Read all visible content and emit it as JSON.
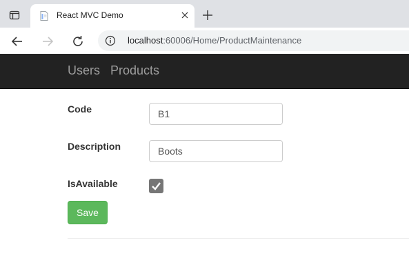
{
  "browser": {
    "tab_title": "React MVC Demo",
    "url_host": "localhost",
    "url_rest": ":60006/Home/ProductMaintenance"
  },
  "navbar": {
    "links": [
      {
        "label": "Users"
      },
      {
        "label": "Products"
      }
    ]
  },
  "form": {
    "code": {
      "label": "Code",
      "value": "B1"
    },
    "description": {
      "label": "Description",
      "value": "Boots"
    },
    "is_available": {
      "label": "IsAvailable",
      "checked": true
    },
    "save_label": "Save"
  },
  "colors": {
    "navbar_bg": "#222222",
    "save_button": "#5cb85c",
    "checkbox": "#767676"
  }
}
